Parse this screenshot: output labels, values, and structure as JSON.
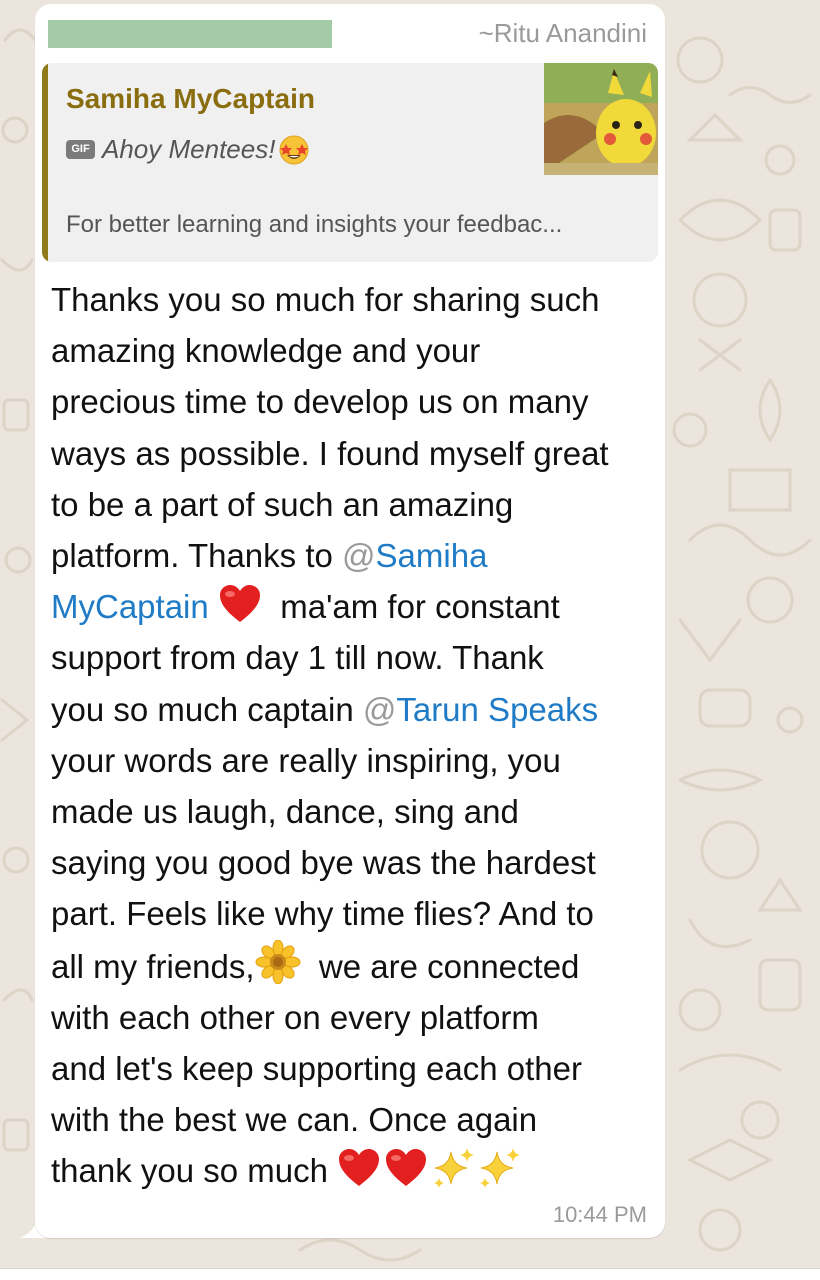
{
  "chat": {
    "background_color": "#ece5dd",
    "message": {
      "sender": {
        "name": "~Ritu Anandini"
      },
      "quoted": {
        "author": "Samiha MyCaptain",
        "media_badge": "GIF",
        "caption": "Ahoy Mentees!",
        "preview_text": "For better learning and insights your feedbac...",
        "bar_color": "#8f7b1a",
        "author_color": "#8a6d0f"
      },
      "body": {
        "lines": [
          "Thanks you so much for sharing such",
          "amazing knowledge and your",
          "precious time to develop us on many",
          "ways as possible. I found myself great",
          "to be a part of such an amazing",
          "platform. Thanks to"
        ],
        "mention_samiha_part1": "Samiha",
        "mention_samiha_part2": "MyCaptain",
        "after_samiha": "ma'am for constant",
        "line_support": "support from day 1 till now. Thank",
        "before_tarun": "you so much captain",
        "mention_tarun": "Tarun Speaks",
        "lines_after_tarun": [
          "your words are really inspiring, you",
          "made us laugh, dance, sing and",
          "saying you good bye was the hardest",
          "part. Feels like why time flies? And to"
        ],
        "before_flower": "all my friends,",
        "after_flower": "we are connected",
        "lines_after_flower": [
          "with each other on every platform",
          "and let's keep supporting each other",
          "with the best we can. Once again"
        ],
        "last_line": "thank you so much",
        "at_symbol": "@",
        "mention_color": "#1f7bc6"
      },
      "time": "10:44 PM"
    }
  }
}
